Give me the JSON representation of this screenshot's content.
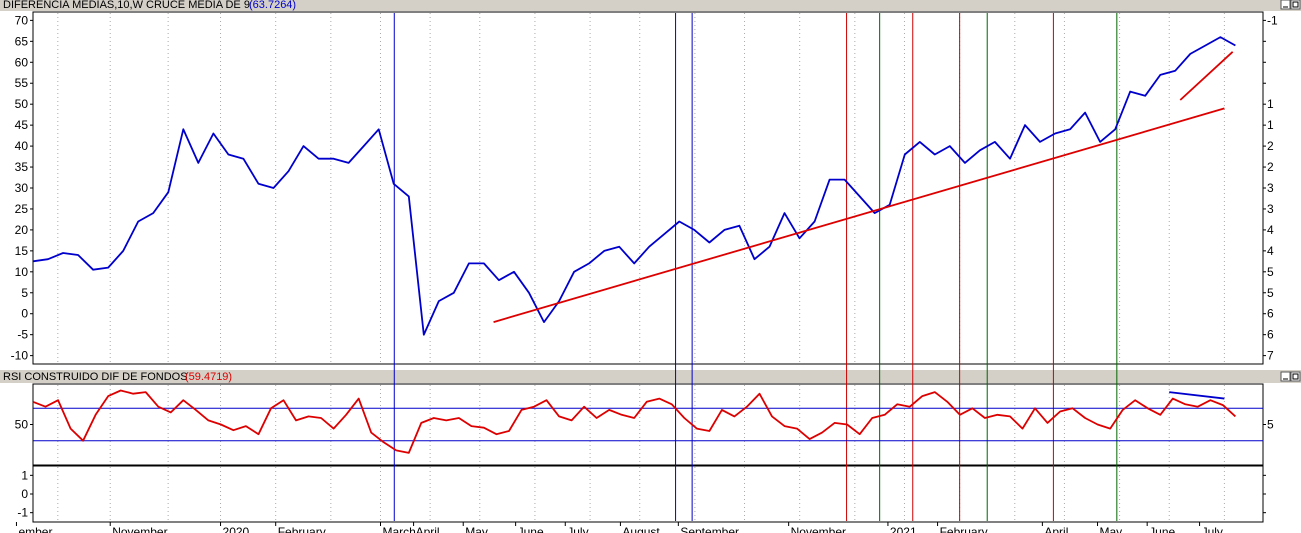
{
  "chart_data": [
    {
      "type": "line",
      "title": "DIFERENCIA  MEDIAS,10,W CRUCE MEDIA DE 9",
      "value_label": "(63.7264)",
      "ylim": [
        -12,
        72
      ],
      "yticks": [
        -10,
        -5,
        0,
        5,
        10,
        15,
        20,
        25,
        30,
        35,
        40,
        45,
        50,
        55,
        60,
        65,
        70
      ],
      "ytick_labels": [
        "-10",
        "-5",
        "0",
        "5",
        "10",
        "15",
        "20",
        "25",
        "30",
        "35",
        "40",
        "45",
        "50",
        "55",
        "60",
        "65",
        "70"
      ],
      "right_tick_labels": [
        "7",
        "6",
        "6",
        "5",
        "5",
        "4",
        "4",
        "3",
        "3",
        "2",
        "2",
        "1",
        "1",
        "",
        "",
        "",
        "-1"
      ],
      "series": [
        {
          "color": "#0000cc",
          "values": [
            12.5,
            13,
            14.5,
            14,
            10.5,
            11,
            15,
            22,
            24,
            29,
            44,
            36,
            43,
            38,
            37,
            31,
            30,
            34,
            40,
            37,
            37,
            36,
            40,
            44,
            31,
            28,
            -5,
            3,
            5,
            12,
            12,
            8,
            10,
            5,
            -2,
            3,
            10,
            12,
            15,
            16,
            12,
            16,
            19,
            22,
            20,
            17,
            20,
            21,
            13,
            16,
            24,
            18,
            22,
            32,
            32,
            28,
            24,
            26,
            38,
            41,
            38,
            40,
            36,
            39,
            41,
            37,
            45,
            41,
            43,
            44,
            48,
            41,
            44,
            53,
            52,
            57,
            58,
            62,
            64,
            66,
            64
          ]
        }
      ],
      "trendlines": [
        {
          "color": "#dd0000",
          "from": [
            83.5,
            -2
          ],
          "to": [
            216,
            49
          ]
        },
        {
          "color": "#dd0000",
          "from": [
            208,
            51
          ],
          "to": [
            217.5,
            62.5
          ]
        }
      ],
      "vlines": [
        {
          "x": 65.5,
          "color": "#0000cc"
        },
        {
          "x": 116.5,
          "color": "#0000cc"
        },
        {
          "x": 119.5,
          "color": "#0000cc"
        },
        {
          "x": 147.5,
          "color": "#cc0000"
        },
        {
          "x": 153.5,
          "color": "#006600"
        },
        {
          "x": 159.5,
          "color": "#cc0000"
        },
        {
          "x": 168,
          "color": "#cc0000"
        },
        {
          "x": 173,
          "color": "#006600"
        },
        {
          "x": 185,
          "color": "#cc0000"
        },
        {
          "x": 196.5,
          "color": "#006600"
        }
      ]
    },
    {
      "type": "line",
      "title": "RSI CONSTRUIDO DIF DE FONDOS",
      "value_label": "(59.4719)",
      "ylim": [
        0,
        100
      ],
      "yticks": [
        50
      ],
      "ytick_labels": [
        "50"
      ],
      "right_tick_labels": [
        "5"
      ],
      "hlines": [
        {
          "y": 70,
          "color": "#0000cc"
        },
        {
          "y": 30,
          "color": "#0000cc"
        }
      ],
      "series": [
        {
          "color": "#dd0000",
          "values": [
            78,
            72,
            80,
            45,
            30,
            62,
            85,
            92,
            88,
            90,
            72,
            65,
            80,
            68,
            55,
            50,
            43,
            48,
            38,
            70,
            80,
            55,
            60,
            58,
            45,
            62,
            82,
            40,
            28,
            18,
            15,
            52,
            58,
            55,
            58,
            48,
            46,
            38,
            42,
            68,
            72,
            80,
            60,
            55,
            72,
            58,
            68,
            62,
            58,
            78,
            82,
            75,
            58,
            45,
            42,
            68,
            60,
            72,
            88,
            60,
            48,
            45,
            32,
            40,
            52,
            50,
            38,
            58,
            62,
            75,
            72,
            85,
            90,
            78,
            62,
            70,
            58,
            62,
            60,
            45,
            70,
            52,
            66,
            70,
            58,
            50,
            45,
            68,
            80,
            70,
            62,
            82,
            75,
            72,
            80,
            74,
            60
          ]
        }
      ],
      "trendlines": [
        {
          "color": "#0000cc",
          "from": [
            206,
            90
          ],
          "to": [
            216,
            82
          ]
        }
      ]
    },
    {
      "type": "line",
      "title": "",
      "ylim": [
        -1.5,
        1.5
      ],
      "yticks": [
        -1,
        0,
        1
      ],
      "ytick_labels": [
        "-1",
        "0",
        "1"
      ],
      "series": []
    }
  ],
  "x_axis": {
    "domain": [
      0,
      223
    ],
    "month_labels": [
      {
        "x": -3,
        "label": "ember"
      },
      {
        "x": 14,
        "label": "November"
      },
      {
        "x": 34,
        "label": "2020"
      },
      {
        "x": 44,
        "label": "February"
      },
      {
        "x": 63,
        "label": "March"
      },
      {
        "x": 69,
        "label": "April"
      },
      {
        "x": 78,
        "label": "May"
      },
      {
        "x": 87.5,
        "label": "June"
      },
      {
        "x": 96.5,
        "label": "July"
      },
      {
        "x": 106.5,
        "label": "August"
      },
      {
        "x": 117,
        "label": "September"
      },
      {
        "x": 137,
        "label": "November"
      },
      {
        "x": 155,
        "label": "2021"
      },
      {
        "x": 164,
        "label": "February"
      },
      {
        "x": 183,
        "label": "April"
      },
      {
        "x": 193,
        "label": "May"
      },
      {
        "x": 202,
        "label": "June"
      },
      {
        "x": 211.5,
        "label": "July"
      }
    ],
    "gridlines": [
      4.5,
      14,
      24.5,
      34,
      44,
      54,
      63,
      72,
      81,
      91,
      101,
      110,
      120,
      129,
      139,
      149,
      158,
      168,
      178,
      187,
      197,
      206,
      216
    ]
  },
  "colors": {
    "panel_title_red": "#dd0000",
    "panel_title_blue": "#0000cc",
    "header_bg": "#d4d0c8"
  },
  "icons": {
    "panel1_buttons": [
      "minimize-icon",
      "maximize-icon"
    ],
    "panel2_buttons": [
      "minimize-icon",
      "maximize-icon"
    ]
  }
}
